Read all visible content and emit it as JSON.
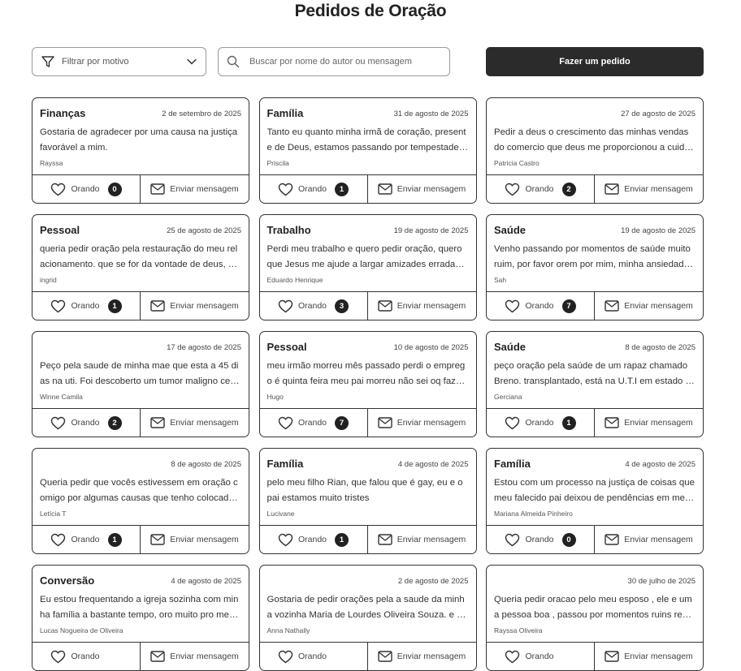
{
  "page": {
    "title": "Pedidos de Oração"
  },
  "toolbar": {
    "filter_label": "Filtrar por motivo",
    "search_placeholder": "Buscar por nome do autor ou mensagem",
    "cta_label": "Fazer um pedido"
  },
  "card_actions": {
    "pray_label": "Orando",
    "message_label": "Enviar mensagem"
  },
  "icons": {
    "filter": "filter-funnel-icon",
    "dropdown": "chevron-down-icon",
    "search": "search-icon",
    "pray": "heart-icon",
    "message": "envelope-icon"
  },
  "requests": [
    {
      "category": "Finanças",
      "date": "2 de setembro de 2025",
      "message": "Gostaria de agradecer por uma causa na justiça favorável a mim.",
      "author": "Rayssa",
      "praying": "0"
    },
    {
      "category": "Família",
      "date": "31 de agosto de 2025",
      "message": "Tanto eu quanto minha irmã de coração, presente de Deus, estamos passando por tempestades…",
      "author": "Priscila",
      "praying": "1"
    },
    {
      "category": "",
      "date": "27 de agosto de 2025",
      "message": "Pedir a deus o crescimento das minhas vendas do comercio que deus me proporcionou a cuida…",
      "author": "Patricia Castro",
      "praying": "2"
    },
    {
      "category": "Pessoal",
      "date": "25 de agosto de 2025",
      "message": "queria pedir oração pela restauração do meu relacionamento. que se for da vontade de deus, el…",
      "author": "ingrid",
      "praying": "1"
    },
    {
      "category": "Trabalho",
      "date": "19 de agosto de 2025",
      "message": "Perdi meu trabalho e quero pedir oração, quero que Jesus me ajude a largar amizades erradas e …",
      "author": "Eduardo Henrique",
      "praying": "3"
    },
    {
      "category": "Saúde",
      "date": "19 de agosto de 2025",
      "message": "Venho passando por momentos de saúde muito ruim, por favor orem por mim, minha ansiedad…",
      "author": "Sah",
      "praying": "7"
    },
    {
      "category": "",
      "date": "17 de agosto de 2025",
      "message": "Peço pela saude de minha mae que esta a 45 dias na uti. Foi descoberto um tumor maligno cereb…",
      "author": "Winne Camila",
      "praying": "2"
    },
    {
      "category": "Pessoal",
      "date": "10 de agosto de 2025",
      "message": "meu irmão morreu mês passado perdi o emprego é quinta feira meu pai morreu não sei oq fazer t…",
      "author": "Hugo",
      "praying": "7"
    },
    {
      "category": "Saúde",
      "date": "8 de agosto de 2025",
      "message": "peço oração pela saúde de um rapaz chamado Breno. transplantado, está na U.T.I em estado gra…",
      "author": "Gerciana",
      "praying": "1"
    },
    {
      "category": "",
      "date": "8 de agosto de 2025",
      "message": "Queria pedir que vocês estivessem em oração comigo por algumas causas que tenho colocado …",
      "author": "Letícia T",
      "praying": "1"
    },
    {
      "category": "Família",
      "date": "4 de agosto de 2025",
      "message": "pelo meu filho Rian, que falou que é gay, eu e o pai estamos muito tristes",
      "author": "Lucivane",
      "praying": "1"
    },
    {
      "category": "Família",
      "date": "4 de agosto de 2025",
      "message": "Estou com um processo na justiça de coisas que meu falecido pai deixou de pendências em me…",
      "author": "Mariana Almeida Pinheiro",
      "praying": "0"
    },
    {
      "category": "Conversão",
      "date": "4 de agosto de 2025",
      "message": "Eu estou frequentando a igreja sozinha com minha família a bastante tempo, oro muito pro meu …",
      "author": "Lucas Nogueira de Oliveira",
      "praying": ""
    },
    {
      "category": "",
      "date": "2 de agosto de 2025",
      "message": "Gostaria de pedir orações pela a saude da minha vozinha Maria de Lourdes Oliveira Souza. e pel…",
      "author": "Anna Nathally",
      "praying": ""
    },
    {
      "category": "",
      "date": "30 de julho de 2025",
      "message": "Queria pedir oracao pelo meu esposo , ele e uma pessoa boa , passou por momentos ruins recen…",
      "author": "Rayssa Oliveira",
      "praying": ""
    }
  ]
}
